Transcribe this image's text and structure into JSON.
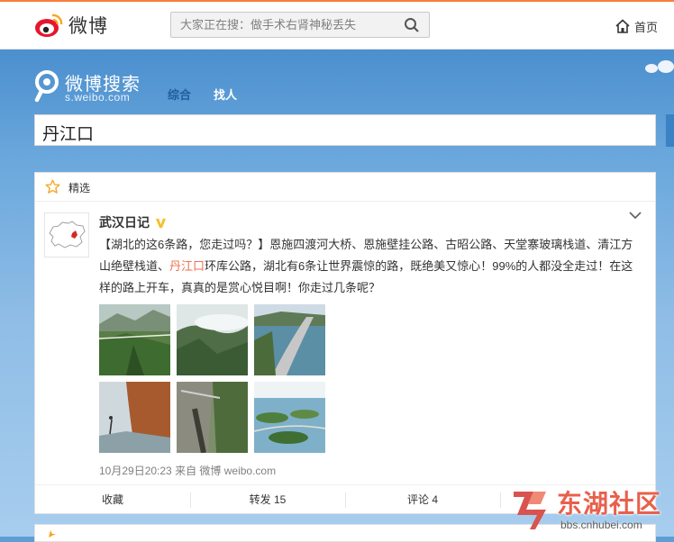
{
  "topbar": {
    "brand": "微博",
    "search_placeholder": "大家正在搜：做手术右肾神秘丢失",
    "home_label": "首页"
  },
  "search_page": {
    "brand_title": "微博搜索",
    "brand_url": "s.weibo.com",
    "tabs": [
      {
        "label": "综合",
        "active": true
      },
      {
        "label": "找人",
        "active": false
      }
    ],
    "query": "丹江口"
  },
  "feed": {
    "section_label": "精选",
    "post": {
      "author": "武汉日记",
      "verified": true,
      "text_before": "【湖北的这6条路，您走过吗？】恩施四渡河大桥、恩施壁挂公路、古昭公路、天堂寨玻璃栈道、清江方山绝壁栈道、",
      "keyword": "丹江口",
      "text_after": "环库公路，湖北有6条让世界震惊的路，既绝美又惊心！99%的人都没全走过！在这样的路上开车，真真的是赏心悦目啊！你走过几条呢？",
      "timestamp": "10月29日20:23",
      "source": "来自 微博 weibo.com",
      "image_count": 6
    },
    "actions": [
      {
        "label": "收藏"
      },
      {
        "label": "转发 15"
      },
      {
        "label": "评论 4"
      },
      {
        "label": ""
      }
    ]
  },
  "watermark": {
    "text": "东湖社区",
    "url": "bbs.cnhubei.com"
  },
  "colors": {
    "accent_orange": "#fa7d3c",
    "keyword": "#eb7350",
    "sky": "#5e9ed6",
    "verified": "#f5c02b"
  }
}
